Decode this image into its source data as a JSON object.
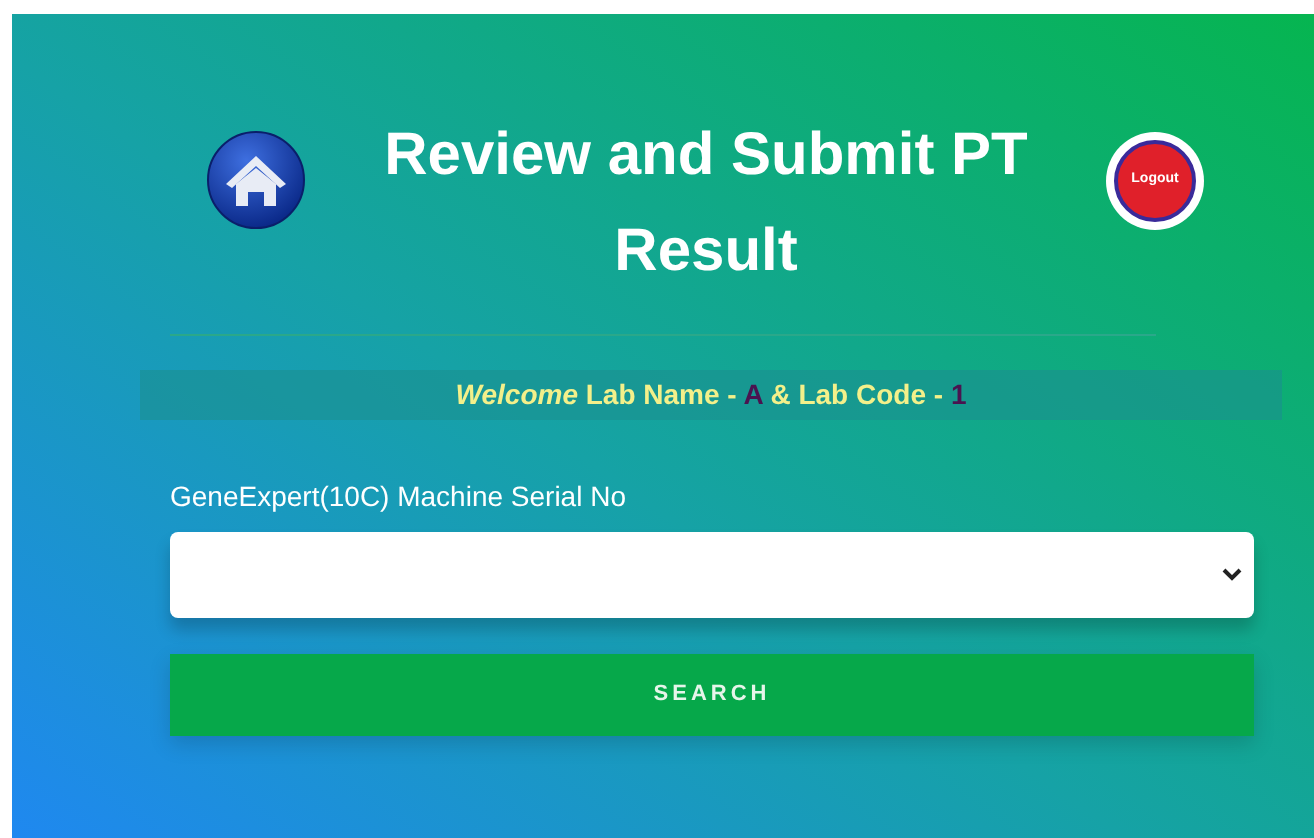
{
  "header": {
    "title": "Review and Submit PT Result",
    "logout_label": "Logout"
  },
  "welcome": {
    "parts": [
      {
        "kind": "greeting",
        "text": "Welcome"
      },
      {
        "kind": "label",
        "text": " Lab Name - "
      },
      {
        "kind": "value",
        "text": "A"
      },
      {
        "kind": "label",
        "text": " & Lab Code - "
      },
      {
        "kind": "value",
        "text": "1"
      }
    ]
  },
  "form": {
    "field_label": "GeneExpert(10C) Machine Serial No",
    "search_button": "SEARCH"
  }
}
